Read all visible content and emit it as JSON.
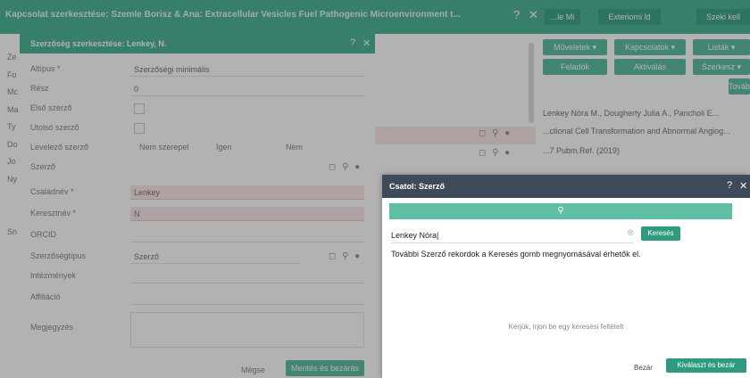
{
  "outer_modal": {
    "title": "Kapcsolat szerkesztése: Szemle Borisz & Ana: Extracellular Vesicles Fuel Pathogenic Microenvironment t...",
    "top_buttons": [
      "...le Mi",
      "Exteriomi ld",
      "Szeki kell"
    ]
  },
  "left_modal": {
    "title": "Szerzőség szerkesztése: Lenkey, N.",
    "fields": [
      {
        "label": "Altípus *",
        "value": "Szerzőségi minimális",
        "required": false
      },
      {
        "label": "Rész",
        "value": "0",
        "required": false
      },
      {
        "label": "Első szerző",
        "value": "",
        "required": false
      },
      {
        "label": "Utolsó szerző",
        "value": "",
        "required": false
      },
      {
        "label": "Levelező szerző",
        "value": "",
        "required": false
      },
      {
        "label": "Szerző",
        "value": "",
        "required": false
      },
      {
        "label": "Családnév *",
        "value": "Lenkey",
        "required": true
      },
      {
        "label": "Keresztnév *",
        "value": "N",
        "required": true
      },
      {
        "label": "ORCID",
        "value": "",
        "required": false
      },
      {
        "label": "Szerzőségtípus",
        "value": "Szerző",
        "required": false
      },
      {
        "label": "Intézmények",
        "value": "",
        "required": false
      },
      {
        "label": "Affiliáció",
        "value": "",
        "required": false
      },
      {
        "label": "Megjegyzés",
        "value": "",
        "required": false
      }
    ],
    "radio_options": [
      "Nem szerepel",
      "Igen",
      "Nem"
    ],
    "footer": {
      "cancel": "Mégse",
      "save": "Mentés és bezárás"
    }
  },
  "left_letters": [
    "Ze",
    "Fo",
    "Mc",
    "Ma",
    "Ty",
    "Do",
    "Jo",
    "Ny",
    "Sn"
  ],
  "right_bg": {
    "buttons_row1": [
      "Műveletek ▾",
      "Kapcsolatok ▾",
      "Listák ▾"
    ],
    "buttons_row2": [
      "Feladók",
      "Aktiválás",
      "Szerkesz ▾"
    ],
    "small_button": "Továb",
    "authors_line": "Lenkey Nóra M.,  Dougherty Julia A.,  Pancholi E...",
    "title_line": "...ctional Cell Transformation and Abnormal Angiog...",
    "doi_line": "...7 Pubm.Ref. (2019)"
  },
  "chooser": {
    "title": "Csatol: Szerző",
    "search_value": "Lenkey Nóra|",
    "search_button": "Keresés",
    "hint": "További Szerző rekordok a Keresés gomb megnyomásával érhetők el.",
    "empty_text": "Kérjük, írjon be egy keresési feltételt",
    "footer": {
      "close": "Bezár",
      "select": "Kiválaszt és bezár"
    }
  }
}
